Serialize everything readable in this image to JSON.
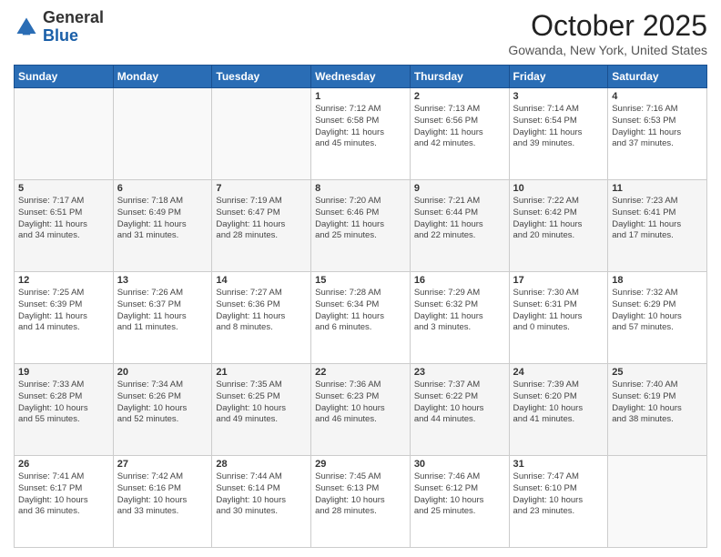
{
  "header": {
    "logo_general": "General",
    "logo_blue": "Blue",
    "month_title": "October 2025",
    "location": "Gowanda, New York, United States"
  },
  "days_of_week": [
    "Sunday",
    "Monday",
    "Tuesday",
    "Wednesday",
    "Thursday",
    "Friday",
    "Saturday"
  ],
  "weeks": [
    [
      {
        "day": "",
        "info": ""
      },
      {
        "day": "",
        "info": ""
      },
      {
        "day": "",
        "info": ""
      },
      {
        "day": "1",
        "info": "Sunrise: 7:12 AM\nSunset: 6:58 PM\nDaylight: 11 hours\nand 45 minutes."
      },
      {
        "day": "2",
        "info": "Sunrise: 7:13 AM\nSunset: 6:56 PM\nDaylight: 11 hours\nand 42 minutes."
      },
      {
        "day": "3",
        "info": "Sunrise: 7:14 AM\nSunset: 6:54 PM\nDaylight: 11 hours\nand 39 minutes."
      },
      {
        "day": "4",
        "info": "Sunrise: 7:16 AM\nSunset: 6:53 PM\nDaylight: 11 hours\nand 37 minutes."
      }
    ],
    [
      {
        "day": "5",
        "info": "Sunrise: 7:17 AM\nSunset: 6:51 PM\nDaylight: 11 hours\nand 34 minutes."
      },
      {
        "day": "6",
        "info": "Sunrise: 7:18 AM\nSunset: 6:49 PM\nDaylight: 11 hours\nand 31 minutes."
      },
      {
        "day": "7",
        "info": "Sunrise: 7:19 AM\nSunset: 6:47 PM\nDaylight: 11 hours\nand 28 minutes."
      },
      {
        "day": "8",
        "info": "Sunrise: 7:20 AM\nSunset: 6:46 PM\nDaylight: 11 hours\nand 25 minutes."
      },
      {
        "day": "9",
        "info": "Sunrise: 7:21 AM\nSunset: 6:44 PM\nDaylight: 11 hours\nand 22 minutes."
      },
      {
        "day": "10",
        "info": "Sunrise: 7:22 AM\nSunset: 6:42 PM\nDaylight: 11 hours\nand 20 minutes."
      },
      {
        "day": "11",
        "info": "Sunrise: 7:23 AM\nSunset: 6:41 PM\nDaylight: 11 hours\nand 17 minutes."
      }
    ],
    [
      {
        "day": "12",
        "info": "Sunrise: 7:25 AM\nSunset: 6:39 PM\nDaylight: 11 hours\nand 14 minutes."
      },
      {
        "day": "13",
        "info": "Sunrise: 7:26 AM\nSunset: 6:37 PM\nDaylight: 11 hours\nand 11 minutes."
      },
      {
        "day": "14",
        "info": "Sunrise: 7:27 AM\nSunset: 6:36 PM\nDaylight: 11 hours\nand 8 minutes."
      },
      {
        "day": "15",
        "info": "Sunrise: 7:28 AM\nSunset: 6:34 PM\nDaylight: 11 hours\nand 6 minutes."
      },
      {
        "day": "16",
        "info": "Sunrise: 7:29 AM\nSunset: 6:32 PM\nDaylight: 11 hours\nand 3 minutes."
      },
      {
        "day": "17",
        "info": "Sunrise: 7:30 AM\nSunset: 6:31 PM\nDaylight: 11 hours\nand 0 minutes."
      },
      {
        "day": "18",
        "info": "Sunrise: 7:32 AM\nSunset: 6:29 PM\nDaylight: 10 hours\nand 57 minutes."
      }
    ],
    [
      {
        "day": "19",
        "info": "Sunrise: 7:33 AM\nSunset: 6:28 PM\nDaylight: 10 hours\nand 55 minutes."
      },
      {
        "day": "20",
        "info": "Sunrise: 7:34 AM\nSunset: 6:26 PM\nDaylight: 10 hours\nand 52 minutes."
      },
      {
        "day": "21",
        "info": "Sunrise: 7:35 AM\nSunset: 6:25 PM\nDaylight: 10 hours\nand 49 minutes."
      },
      {
        "day": "22",
        "info": "Sunrise: 7:36 AM\nSunset: 6:23 PM\nDaylight: 10 hours\nand 46 minutes."
      },
      {
        "day": "23",
        "info": "Sunrise: 7:37 AM\nSunset: 6:22 PM\nDaylight: 10 hours\nand 44 minutes."
      },
      {
        "day": "24",
        "info": "Sunrise: 7:39 AM\nSunset: 6:20 PM\nDaylight: 10 hours\nand 41 minutes."
      },
      {
        "day": "25",
        "info": "Sunrise: 7:40 AM\nSunset: 6:19 PM\nDaylight: 10 hours\nand 38 minutes."
      }
    ],
    [
      {
        "day": "26",
        "info": "Sunrise: 7:41 AM\nSunset: 6:17 PM\nDaylight: 10 hours\nand 36 minutes."
      },
      {
        "day": "27",
        "info": "Sunrise: 7:42 AM\nSunset: 6:16 PM\nDaylight: 10 hours\nand 33 minutes."
      },
      {
        "day": "28",
        "info": "Sunrise: 7:44 AM\nSunset: 6:14 PM\nDaylight: 10 hours\nand 30 minutes."
      },
      {
        "day": "29",
        "info": "Sunrise: 7:45 AM\nSunset: 6:13 PM\nDaylight: 10 hours\nand 28 minutes."
      },
      {
        "day": "30",
        "info": "Sunrise: 7:46 AM\nSunset: 6:12 PM\nDaylight: 10 hours\nand 25 minutes."
      },
      {
        "day": "31",
        "info": "Sunrise: 7:47 AM\nSunset: 6:10 PM\nDaylight: 10 hours\nand 23 minutes."
      },
      {
        "day": "",
        "info": ""
      }
    ]
  ]
}
